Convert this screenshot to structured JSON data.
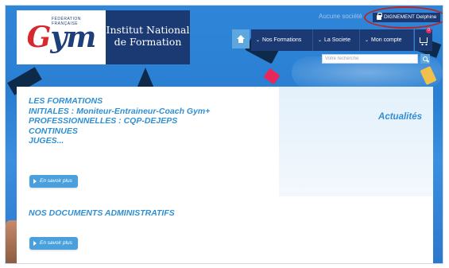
{
  "header": {
    "logo": {
      "text_g": "G",
      "text_ym": "ym",
      "sub": "FÉDÉRATION FRANÇAISE"
    },
    "org_name_line1": "Institut National",
    "org_name_line2": "de Formation",
    "top_link": "Aucune société",
    "user_button": "DIGNEMENT Delphine",
    "highlight_color": "#b8262b"
  },
  "nav": {
    "home_icon": "home-icon",
    "items": [
      {
        "label": "Nos Formations"
      },
      {
        "label": "La Societe"
      },
      {
        "label": "Mon compte"
      }
    ],
    "cart_icon": "cart-icon",
    "cart_count": "0"
  },
  "search": {
    "placeholder": "Votre recherche",
    "icon": "search-icon"
  },
  "main": {
    "formations_lines": [
      "LES FORMATIONS",
      "INITIALES : Moniteur-Entraineur-Coach Gym+",
      "PROFESSIONNELLES : CQP-DEJEPS",
      "CONTINUES",
      "JUGES..."
    ],
    "more_button_1": "En savoir plus",
    "docs_title": "NOS DOCUMENTS ADMINISTRATIFS",
    "more_button_2": "En savoir plus",
    "news_title": "Actualités"
  },
  "colors": {
    "navy": "#1b3a73",
    "accent_blue": "#2f8fd4",
    "button_blue": "#4aa0dc",
    "light_blue": "#5ea7de"
  }
}
